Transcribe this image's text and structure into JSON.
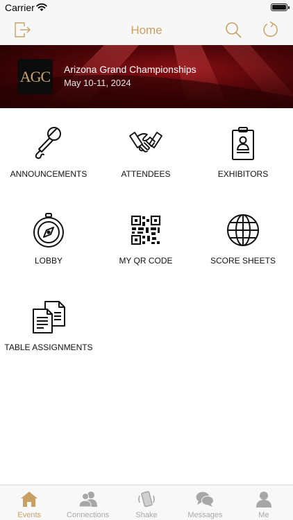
{
  "status_bar": {
    "carrier": "Carrier"
  },
  "nav": {
    "title": "Home"
  },
  "event": {
    "logo_text": "AGC",
    "title": "Arizona Grand Championships",
    "dates": "May 10-11, 2024"
  },
  "tiles": [
    {
      "label": "ANNOUNCEMENTS",
      "icon": "microphone-icon"
    },
    {
      "label": "ATTENDEES",
      "icon": "handshake-icon"
    },
    {
      "label": "EXHIBITORS",
      "icon": "id-badge-icon"
    },
    {
      "label": "LOBBY",
      "icon": "compass-icon"
    },
    {
      "label": "MY QR CODE",
      "icon": "qr-code-icon"
    },
    {
      "label": "SCORE SHEETS",
      "icon": "globe-icon"
    },
    {
      "label": "TABLE ASSIGNMENTS",
      "icon": "documents-icon"
    }
  ],
  "tabs": [
    {
      "label": "Events",
      "icon": "house-icon",
      "active": true
    },
    {
      "label": "Connections",
      "icon": "people-icon",
      "active": false
    },
    {
      "label": "Shake",
      "icon": "phone-shake-icon",
      "active": false
    },
    {
      "label": "Messages",
      "icon": "chat-bubbles-icon",
      "active": false
    },
    {
      "label": "Me",
      "icon": "person-icon",
      "active": false
    }
  ],
  "colors": {
    "accent": "#c8a063",
    "tab_inactive": "#a7a7a7",
    "banner_red": "#8a0f14",
    "icon_stroke": "#111111"
  }
}
